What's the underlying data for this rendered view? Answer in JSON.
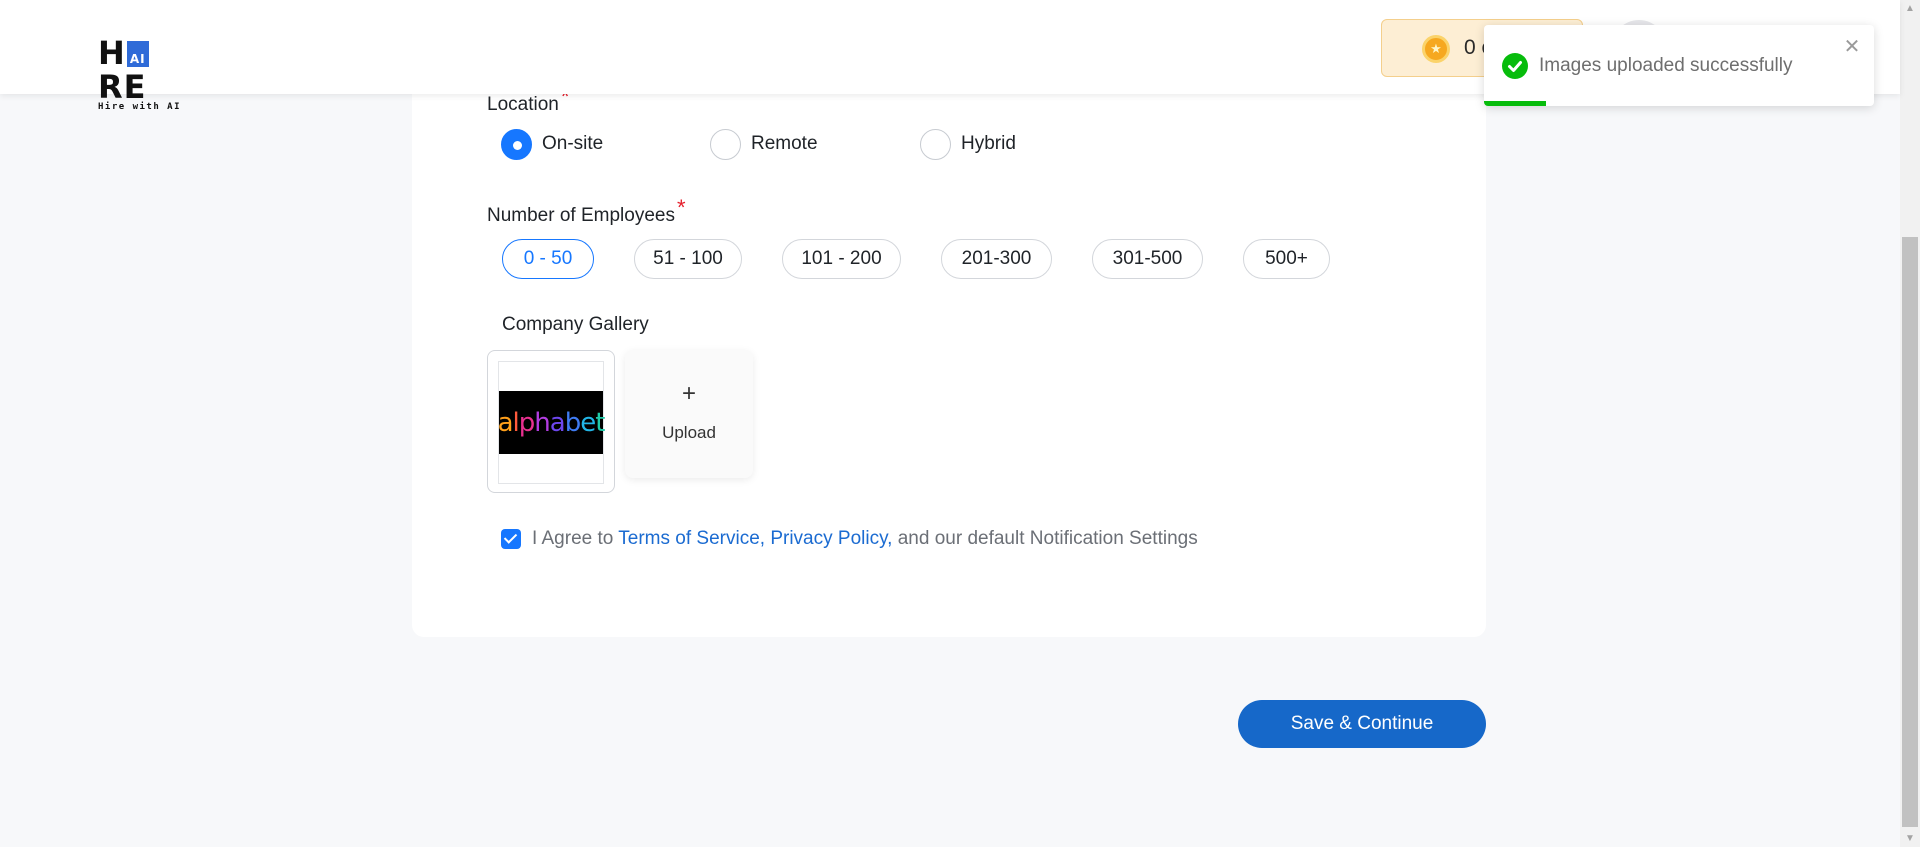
{
  "header": {
    "logo_text": "HIRE",
    "logo_ai": "AI",
    "logo_tagline": "Hire with AI",
    "credits_value": "0 c"
  },
  "toast": {
    "message": "Images uploaded successfully",
    "close_glyph": "✕",
    "status_color": "#07bc0c",
    "progress_fraction": 0.16
  },
  "form": {
    "location": {
      "label": "Location",
      "required_mark": "*",
      "options": [
        "On-site",
        "Remote",
        "Hybrid"
      ],
      "selected": "On-site"
    },
    "employees": {
      "label": "Number of Employees",
      "required_mark": "*",
      "options": [
        "0 - 50",
        "51 - 100",
        "101 - 200",
        "201-300",
        "301-500",
        "500+"
      ],
      "selected": "0 - 50"
    },
    "gallery": {
      "label": "Company Gallery",
      "images": [
        {
          "logo_text": "alphabet"
        }
      ],
      "upload_plus": "+",
      "upload_label": "Upload"
    },
    "agreement": {
      "checked": true,
      "prefix": "I Agree to",
      "terms_link": "Terms of Service,",
      "privacy_link": "Privacy Policy,",
      "suffix": "and our default Notification Settings"
    },
    "save_button": "Save & Continue"
  },
  "colors": {
    "accent": "#1677ff",
    "primary_button": "#1668c9",
    "required": "#e5202d",
    "credits_bg": "#fdeed4"
  }
}
